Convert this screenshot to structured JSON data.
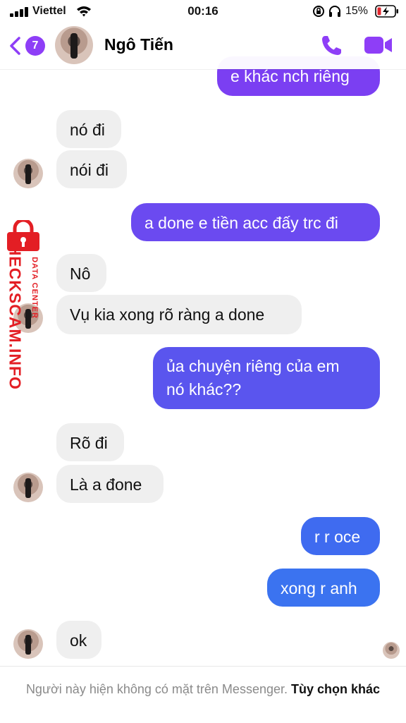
{
  "status_bar": {
    "carrier": "Viettel",
    "time": "00:16",
    "battery": "15%"
  },
  "header": {
    "unread_count": "7",
    "contact_name": "Ngô Tiến"
  },
  "messages": [
    {
      "dir": "out",
      "text": "e khác nch riêng",
      "color": "#7b3ff2"
    },
    {
      "dir": "in",
      "text": "nó đi"
    },
    {
      "dir": "in",
      "text": "nói đi"
    },
    {
      "dir": "out",
      "text": "a done e tiền acc đấy trc đi",
      "color": "#6b4af0"
    },
    {
      "dir": "in",
      "text": "Nô"
    },
    {
      "dir": "in",
      "text": "Vụ kia xong rõ ràng a done"
    },
    {
      "dir": "out",
      "text": "ủa chuyện riêng của em",
      "text2": "nó khác??",
      "color": "#5a55ee"
    },
    {
      "dir": "in",
      "text": "Rõ đi"
    },
    {
      "dir": "in",
      "text": "Là a đone"
    },
    {
      "dir": "out",
      "text": "r r oce",
      "color": "#3f6bf0"
    },
    {
      "dir": "out",
      "text": "xong r anh",
      "color": "#3b73f0"
    },
    {
      "dir": "in",
      "text": "ok"
    }
  ],
  "watermark": {
    "brand": "CHECKSCAM.INFO",
    "sub": "DATA CENTER"
  },
  "footer": {
    "notice": "Người này hiện không có mặt trên Messenger.",
    "other_options": "Tùy chọn khác"
  },
  "colors": {
    "accent": "#8e3ef7",
    "incoming_bubble": "#efefef",
    "watermark": "#e31e24"
  }
}
